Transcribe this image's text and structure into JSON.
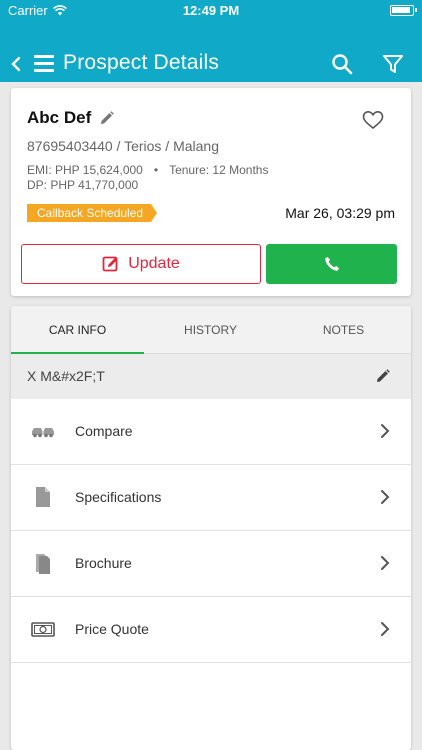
{
  "status_bar": {
    "carrier": "Carrier",
    "time": "12:49 PM"
  },
  "header": {
    "title": "Prospect Details"
  },
  "prospect": {
    "name": "Abc Def",
    "phone_model_city": "87695403440 / Terios / Malang",
    "emi": "EMI: PHP 15,624,000",
    "separator": "•",
    "tenure": "Tenure: 12 Months",
    "dp": "DP: PHP 41,770,000",
    "status_badge": "Callback Scheduled",
    "callback_datetime": "Mar 26, 03:29 pm"
  },
  "actions": {
    "update_label": "Update"
  },
  "tabs": [
    {
      "label": "CAR INFO",
      "active": true
    },
    {
      "label": "HISTORY",
      "active": false
    },
    {
      "label": "NOTES",
      "active": false
    }
  ],
  "variant": {
    "text": "X M&#x2F;T"
  },
  "car_info_items": [
    {
      "label": "Compare",
      "icon": "compare-cars-icon"
    },
    {
      "label": "Specifications",
      "icon": "document-icon"
    },
    {
      "label": "Brochure",
      "icon": "brochure-icon"
    },
    {
      "label": "Price Quote",
      "icon": "money-icon"
    }
  ],
  "colors": {
    "header": "#10a9c7",
    "accent_green": "#20b24c",
    "update_red": "#e0273c",
    "badge_orange": "#f5a623"
  }
}
